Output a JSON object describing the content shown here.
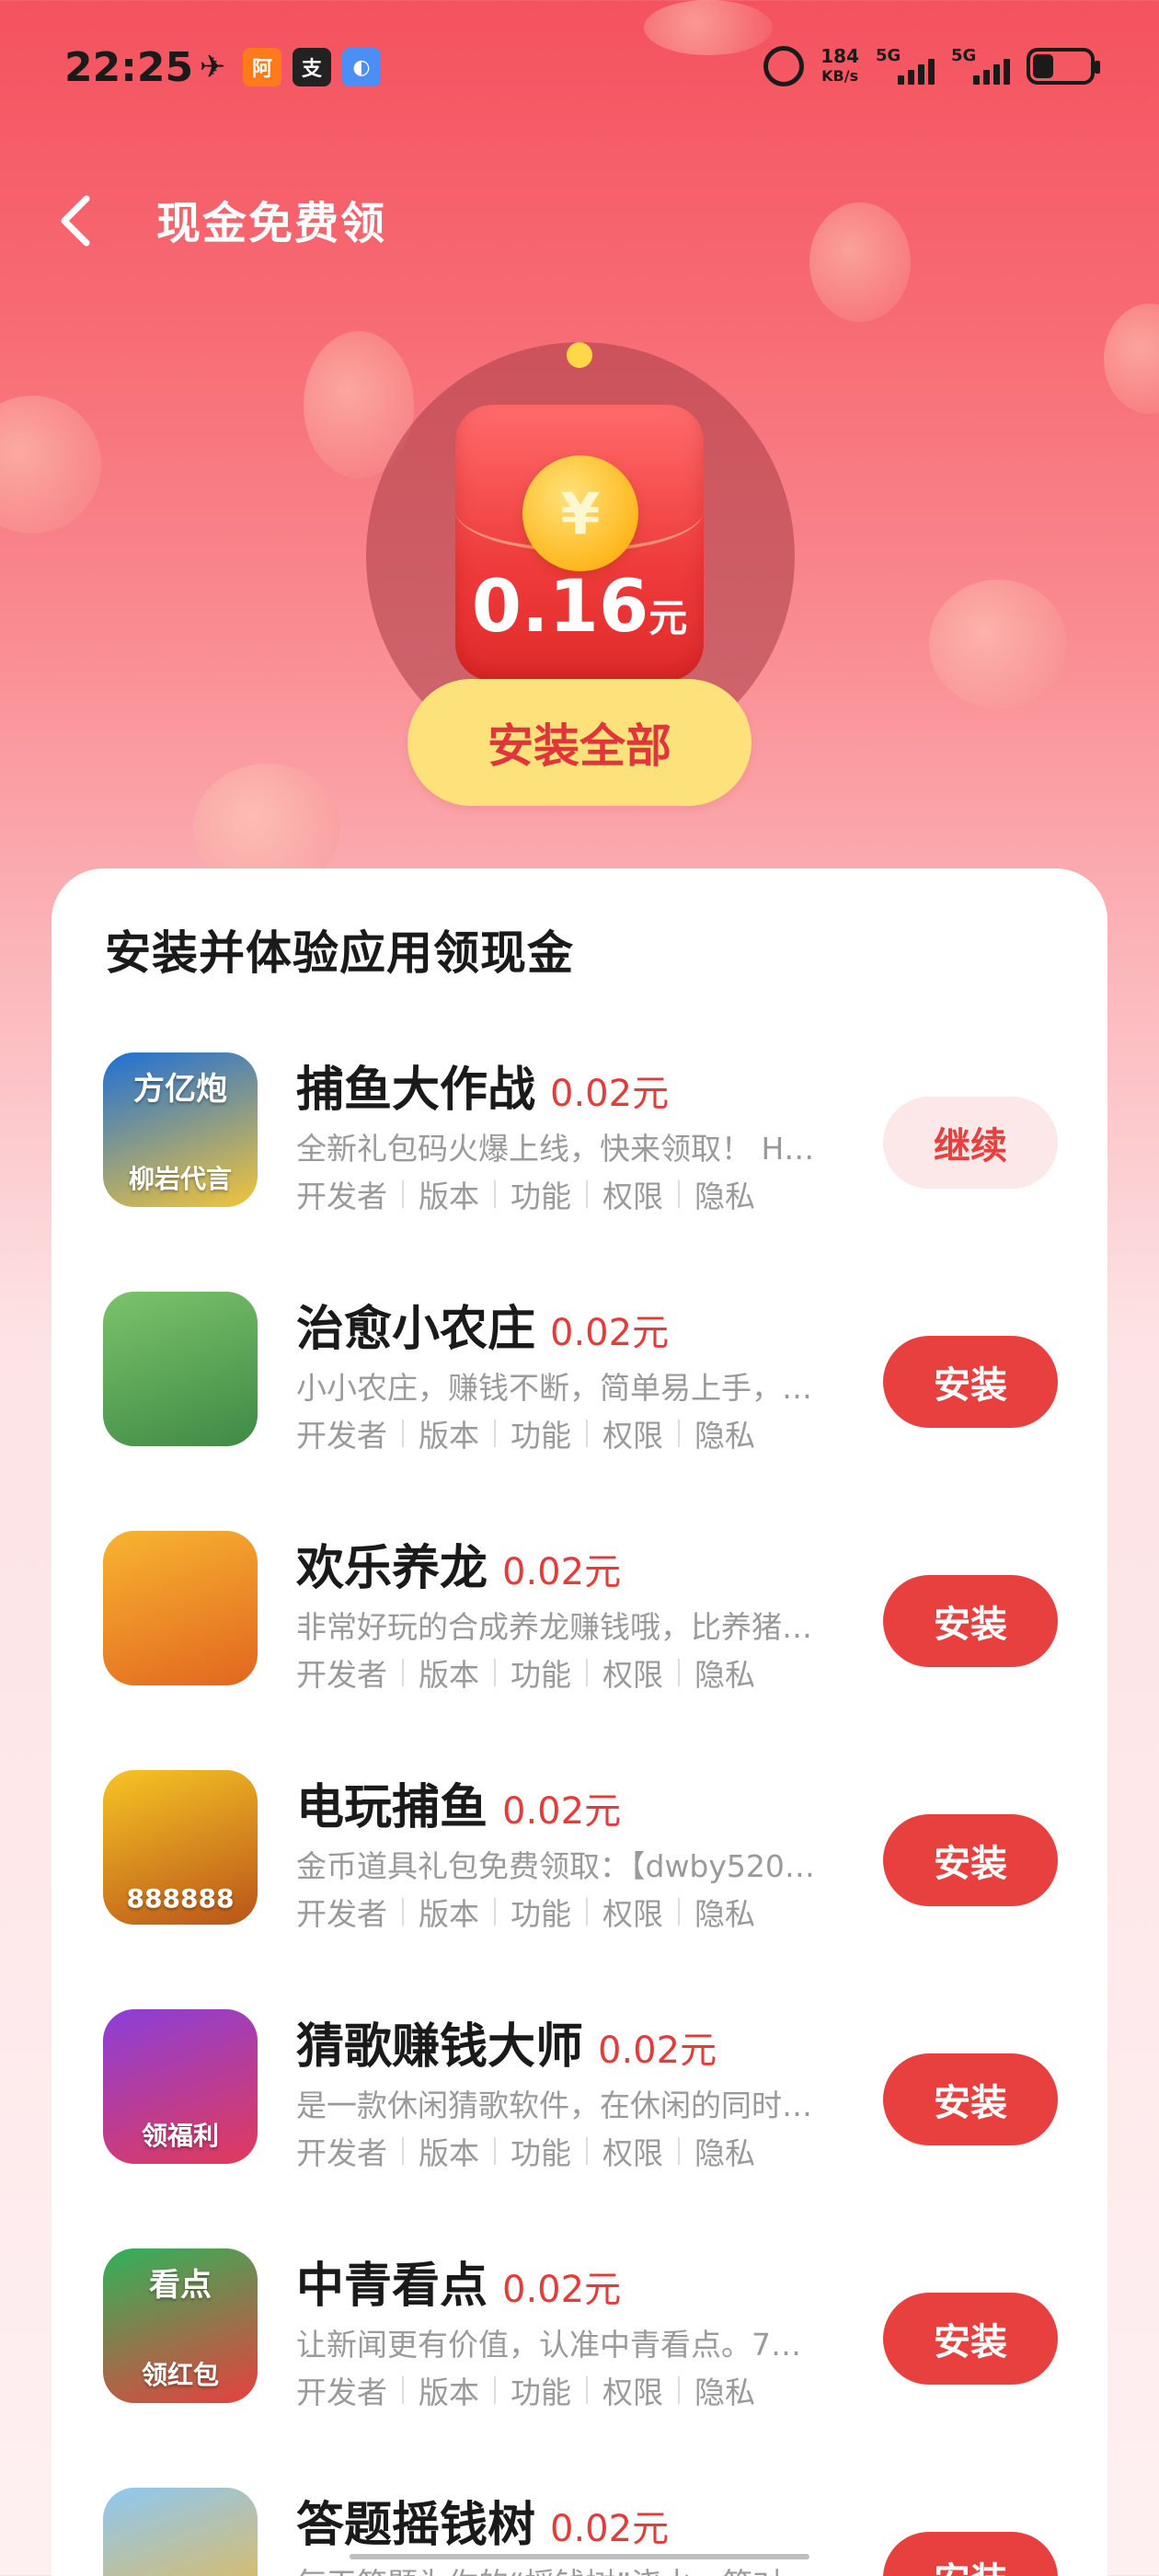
{
  "status_bar": {
    "time": "22:25",
    "icons": [
      "bird-icon",
      "alibaba-1688-icon",
      "alipay-icon",
      "blue-app-icon"
    ],
    "speed_value": "184",
    "speed_unit": "KB/s",
    "network1": "5G",
    "network2": "5G"
  },
  "header": {
    "title": "现金免费领"
  },
  "hero": {
    "coin_symbol": "¥",
    "amount": "0.16",
    "unit": "元",
    "install_all_label": "安装全部"
  },
  "card": {
    "title": "安装并体验应用领现金",
    "links": [
      "开发者",
      "版本",
      "功能",
      "权限",
      "隐私"
    ],
    "apps": [
      {
        "name": "捕鱼大作战",
        "reward": "0.02元",
        "desc": "全新礼包码火爆上线，快来领取！ H…",
        "action": "继续",
        "icon_top": "方亿炮",
        "icon_bottom": "柳岩代言",
        "colors": [
          "#1e6fd6",
          "#f2c53a"
        ]
      },
      {
        "name": "治愈小农庄",
        "reward": "0.02元",
        "desc": "小小农庄，赚钱不断，简单易上手，…",
        "action": "安装",
        "icon_top": "",
        "icon_bottom": "",
        "colors": [
          "#7cc36b",
          "#3e8a46"
        ]
      },
      {
        "name": "欢乐养龙",
        "reward": "0.02元",
        "desc": "非常好玩的合成养龙赚钱哦，比养猪…",
        "action": "安装",
        "icon_top": "",
        "icon_bottom": "",
        "colors": [
          "#f7b531",
          "#e2661f"
        ]
      },
      {
        "name": "电玩捕鱼",
        "reward": "0.02元",
        "desc": "金币道具礼包免费领取：【dwby520…",
        "action": "安装",
        "icon_top": "",
        "icon_bottom": "888888",
        "colors": [
          "#f6c524",
          "#b9541a"
        ]
      },
      {
        "name": "猜歌赚钱大师",
        "reward": "0.02元",
        "desc": "是一款休闲猜歌软件，在休闲的同时…",
        "action": "安装",
        "icon_top": "",
        "icon_bottom": "领福利",
        "colors": [
          "#8b3fd9",
          "#e23a5a"
        ]
      },
      {
        "name": "中青看点",
        "reward": "0.02元",
        "desc": "让新闻更有价值，认准中青看点。7…",
        "action": "安装",
        "icon_top": "看点",
        "icon_bottom": "领红包",
        "colors": [
          "#2fb35a",
          "#e8403e"
        ]
      },
      {
        "name": "答题摇钱树",
        "reward": "0.02元",
        "desc": "每天答题为你的“摇钱树”浇水，答对…",
        "action": "安装",
        "icon_top": "",
        "icon_bottom": "",
        "colors": [
          "#8ec8f3",
          "#f5b73a"
        ]
      }
    ]
  }
}
